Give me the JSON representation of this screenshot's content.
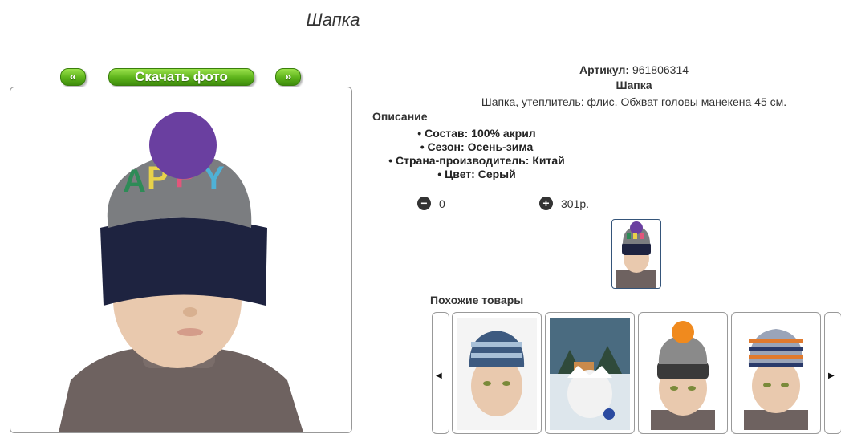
{
  "page": {
    "title": "Шапка"
  },
  "gallery": {
    "prev_label": "«",
    "download_label": "Скачать фото",
    "next_label": "»"
  },
  "product": {
    "article_label": "Артикул:",
    "article_value": "961806314",
    "name": "Шапка",
    "short_description": "Шапка, утеплитель: флис. Обхват головы манекена 45 см.",
    "description_heading": "Описание",
    "attributes": [
      "Состав: 100% акрил",
      "Сезон: Осень-зима",
      "Страна-производитель: Китай",
      "Цвет: Серый"
    ],
    "quantity": "0",
    "price": "301р."
  },
  "similar": {
    "heading": "Похожие товары",
    "prev_icon": "prev-icon",
    "next_icon": "next-icon"
  },
  "colors": {
    "button_green": "#5cb21a",
    "hat_gray": "#7b7d80",
    "hat_navy": "#1e2340",
    "pompom": "#6a3fa0"
  }
}
